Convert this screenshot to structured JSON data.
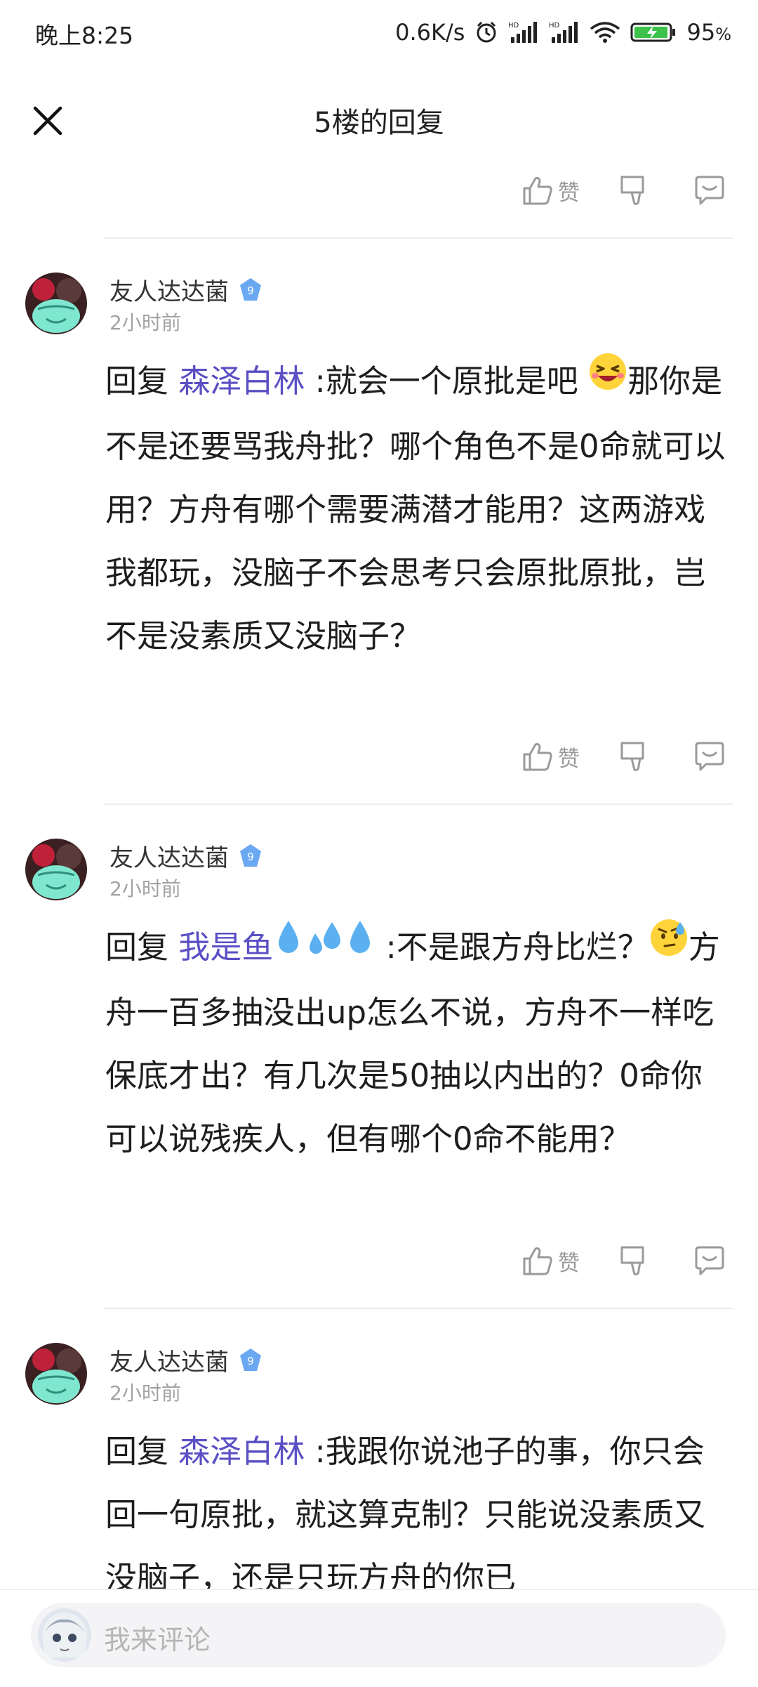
{
  "status_bar": {
    "time": "晚上8:25",
    "net_speed": "0.6K/s",
    "battery": "95"
  },
  "header": {
    "title": "5楼的回复"
  },
  "actions": {
    "like_label": "赞"
  },
  "comments": [
    {
      "username": "友人达达菌",
      "level": "9",
      "time": "2小时前",
      "reply_prefix": "回复 ",
      "reply_to": "森泽白林",
      "text": " :就会一个原批是吧 ",
      "text_after_emoji": "那你是不是还要骂我舟批？哪个角色不是0命就可以用？方舟有哪个需要满潜才能用？这两游戏我都玩，没脑子不会思考只会原批原批，岂不是没素质又没脑子？"
    },
    {
      "username": "友人达达菌",
      "level": "9",
      "time": "2小时前",
      "reply_prefix": "回复 ",
      "reply_to": "我是鱼",
      "text": " :不是跟方舟比烂？",
      "text_after_emoji": "方舟一百多抽没出up怎么不说，方舟不一样吃保底才出？有几次是50抽以内出的？0命你可以说残疾人，但有哪个0命不能用？"
    },
    {
      "username": "友人达达菌",
      "level": "9",
      "time": "2小时前",
      "reply_prefix": "回复 ",
      "reply_to": "森泽白林",
      "text": " :我跟你说池子的事，你只会回一句原批，就这算克制？只能说没素质又没脑子，还是只玩方舟的你已"
    }
  ],
  "comment_input": {
    "placeholder": "我来评论"
  },
  "colors": {
    "accent_link": "#5a4fc4",
    "icon_gray": "#9a9a9a",
    "battery_green": "#3cc24a"
  }
}
